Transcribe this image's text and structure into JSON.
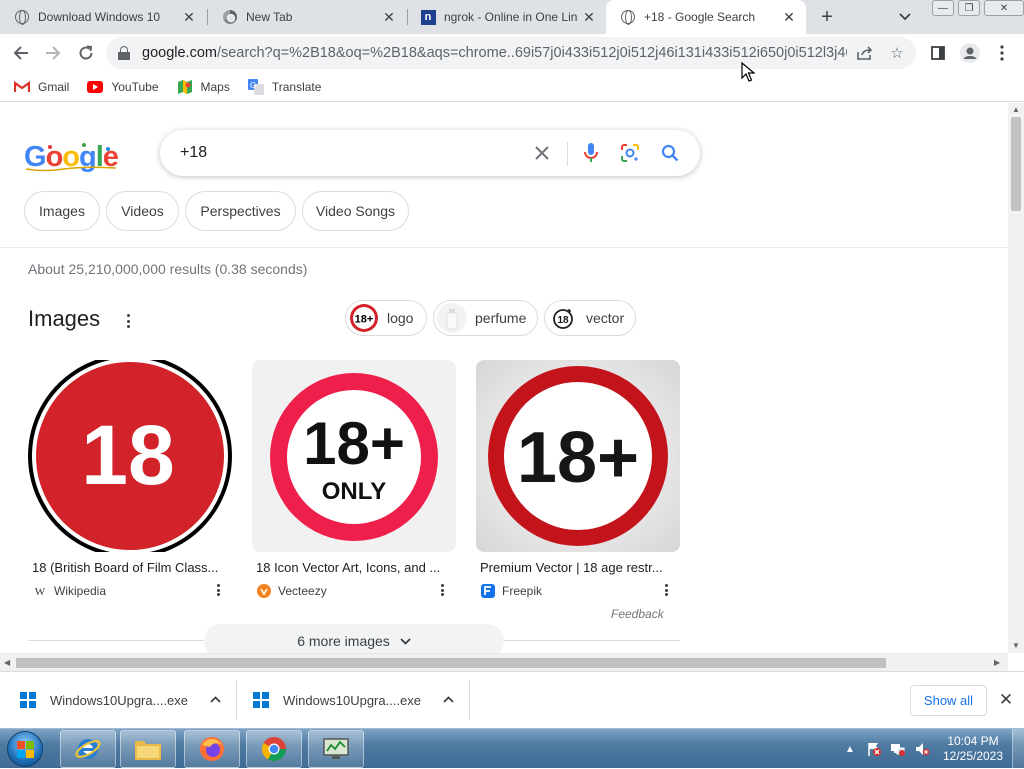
{
  "browser": {
    "tabs": [
      {
        "title": "Download Windows 10",
        "icon": "globe-icon",
        "active": false
      },
      {
        "title": "New Tab",
        "icon": "chrome-icon",
        "active": false
      },
      {
        "title": "ngrok - Online in One Lin",
        "icon": "ngrok-icon",
        "active": false
      },
      {
        "title": "+18 - Google Search",
        "icon": "globe-icon",
        "active": true
      }
    ],
    "new_tab_label": "+",
    "url_host": "google.com",
    "url_rest": "/search?q=%2B18&oq=%2B18&aqs=chrome..69i57j0i433i512j0i512j46i131i433i512i650j0i512l3j46i5...",
    "bookmarks": [
      {
        "label": "Gmail",
        "icon": "gmail-icon"
      },
      {
        "label": "YouTube",
        "icon": "youtube-icon"
      },
      {
        "label": "Maps",
        "icon": "maps-icon"
      },
      {
        "label": "Translate",
        "icon": "translate-icon"
      }
    ]
  },
  "search": {
    "logo_text": "Google",
    "query": "+18",
    "filters": [
      "Images",
      "Videos",
      "Perspectives",
      "Video Songs"
    ],
    "stats": "About 25,210,000,000 results (0.38 seconds)"
  },
  "images_section": {
    "title": "Images",
    "related": [
      {
        "label": "logo",
        "thumb": "18+"
      },
      {
        "label": "perfume",
        "thumb": ""
      },
      {
        "label": "vector",
        "thumb": "18"
      }
    ],
    "results": [
      {
        "title": "18 (British Board of Film Class...",
        "source": "Wikipedia",
        "image_text": "18",
        "source_icon": "wikipedia-icon"
      },
      {
        "title": "18 Icon Vector Art, Icons, and ...",
        "source": "Vecteezy",
        "image_text": "18+",
        "image_subtext": "ONLY",
        "source_icon": "vecteezy-icon"
      },
      {
        "title": "Premium Vector | 18 age restr...",
        "source": "Freepik",
        "image_text": "18+",
        "source_icon": "freepik-icon"
      }
    ],
    "feedback": "Feedback",
    "more_images": "6 more images"
  },
  "downloads": {
    "items": [
      {
        "name": "Windows10Upgra....exe"
      },
      {
        "name": "Windows10Upgra....exe"
      }
    ],
    "show_all": "Show all"
  },
  "taskbar": {
    "apps": [
      "internet-explorer",
      "file-explorer",
      "firefox",
      "chrome",
      "task-manager"
    ],
    "time": "10:04 PM",
    "date": "12/25/2023"
  },
  "colors": {
    "accent_blue": "#1a73e8",
    "badge_red": "#d2232a",
    "tab_strip": "#dee1e6"
  }
}
